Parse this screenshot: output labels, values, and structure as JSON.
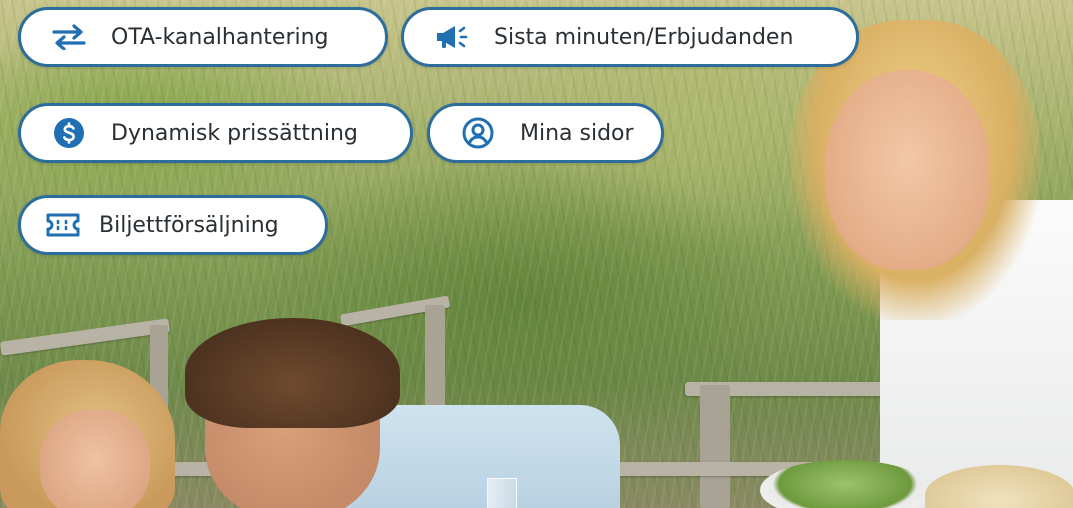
{
  "features": {
    "ota": {
      "label": "OTA-kanalhantering",
      "icon": "swap-arrows-icon"
    },
    "last_minute": {
      "label": "Sista minuten/Erbjudanden",
      "icon": "megaphone-icon"
    },
    "dynamic_pricing": {
      "label": "Dynamisk prissättning",
      "icon": "dollar-circle-icon"
    },
    "my_pages": {
      "label": "Mina sidor",
      "icon": "user-circle-icon"
    },
    "tickets": {
      "label": "Biljettförsäljning",
      "icon": "ticket-icon"
    }
  },
  "colors": {
    "accent": "#1f6fb2",
    "pill_border": "#2d6d9b",
    "pill_background": "#ffffff",
    "text": "#2a2f33"
  },
  "background": {
    "type": "photo",
    "scene": "family-picnic-dunes"
  }
}
